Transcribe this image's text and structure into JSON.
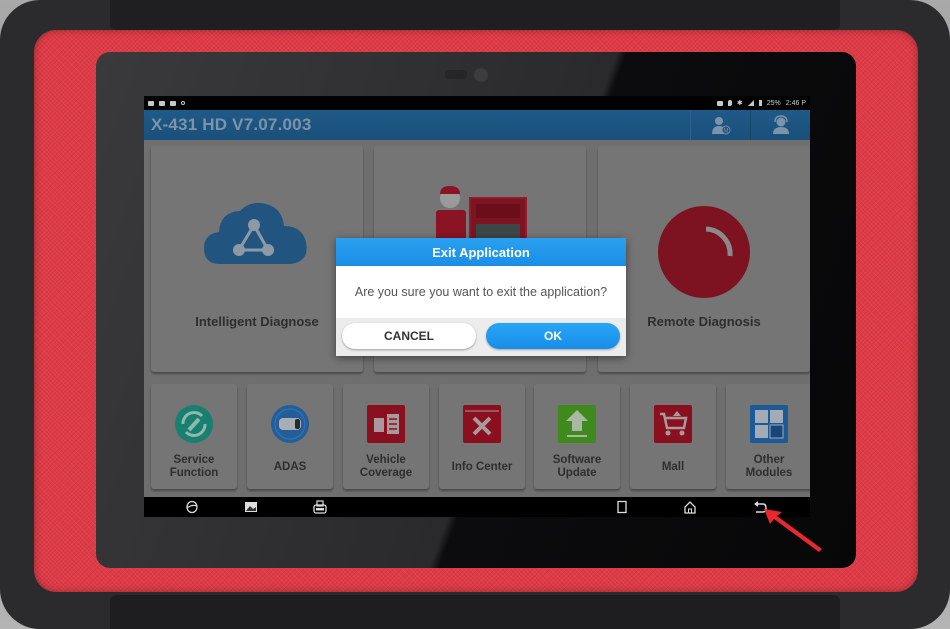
{
  "device": {
    "frame_color": "#e03a45",
    "annotation_arrow_color": "#e8272f"
  },
  "statusbar": {
    "left_icons": [
      "gallery-notification-icon",
      "notification-icon",
      "notification-icon",
      "settings-notification-icon"
    ],
    "right_icons": [
      "cast-icon",
      "location-icon",
      "bluetooth-icon",
      "signal-icon",
      "battery-icon"
    ],
    "battery": "25%",
    "time": "2:46 P"
  },
  "appbar": {
    "title": "X-431 HD V7.07.003",
    "actions": [
      {
        "name": "user-login-icon"
      },
      {
        "name": "support-agent-icon"
      }
    ]
  },
  "main": {
    "big_cards": [
      {
        "label": "Intelligent Diagnose",
        "icon": "cloud-share-icon"
      },
      {
        "label": "",
        "icon": "mechanic-diagnosis-icon"
      },
      {
        "label": "Remote Diagnosis",
        "icon": "remote-target-icon"
      }
    ],
    "small_cards": [
      {
        "label": "Service\nFunction",
        "icon": "wrench-refresh-icon",
        "color": "#18806f"
      },
      {
        "label": "ADAS",
        "icon": "car-radar-icon",
        "color": "#235d9a"
      },
      {
        "label": "Vehicle\nCoverage",
        "icon": "vehicle-list-icon",
        "color": "#8a1020"
      },
      {
        "label": "Info Center",
        "icon": "tools-icon",
        "color": "#8a1020"
      },
      {
        "label": "Software\nUpdate",
        "icon": "upload-arrow-icon",
        "color": "#3f8a1c"
      },
      {
        "label": "Mall",
        "icon": "shopping-cart-icon",
        "color": "#8a1020"
      },
      {
        "label": "Other\nModules",
        "icon": "grid-modules-icon",
        "color": "#1d5a98"
      }
    ]
  },
  "dialog": {
    "title": "Exit Application",
    "message": "Are you sure you want to exit the application?",
    "cancel_label": "CANCEL",
    "ok_label": "OK"
  },
  "navbar": {
    "buttons": [
      "browser-icon",
      "screenshot-icon",
      "vci-icon",
      "recent-apps-icon",
      "home-icon",
      "back-icon"
    ]
  }
}
